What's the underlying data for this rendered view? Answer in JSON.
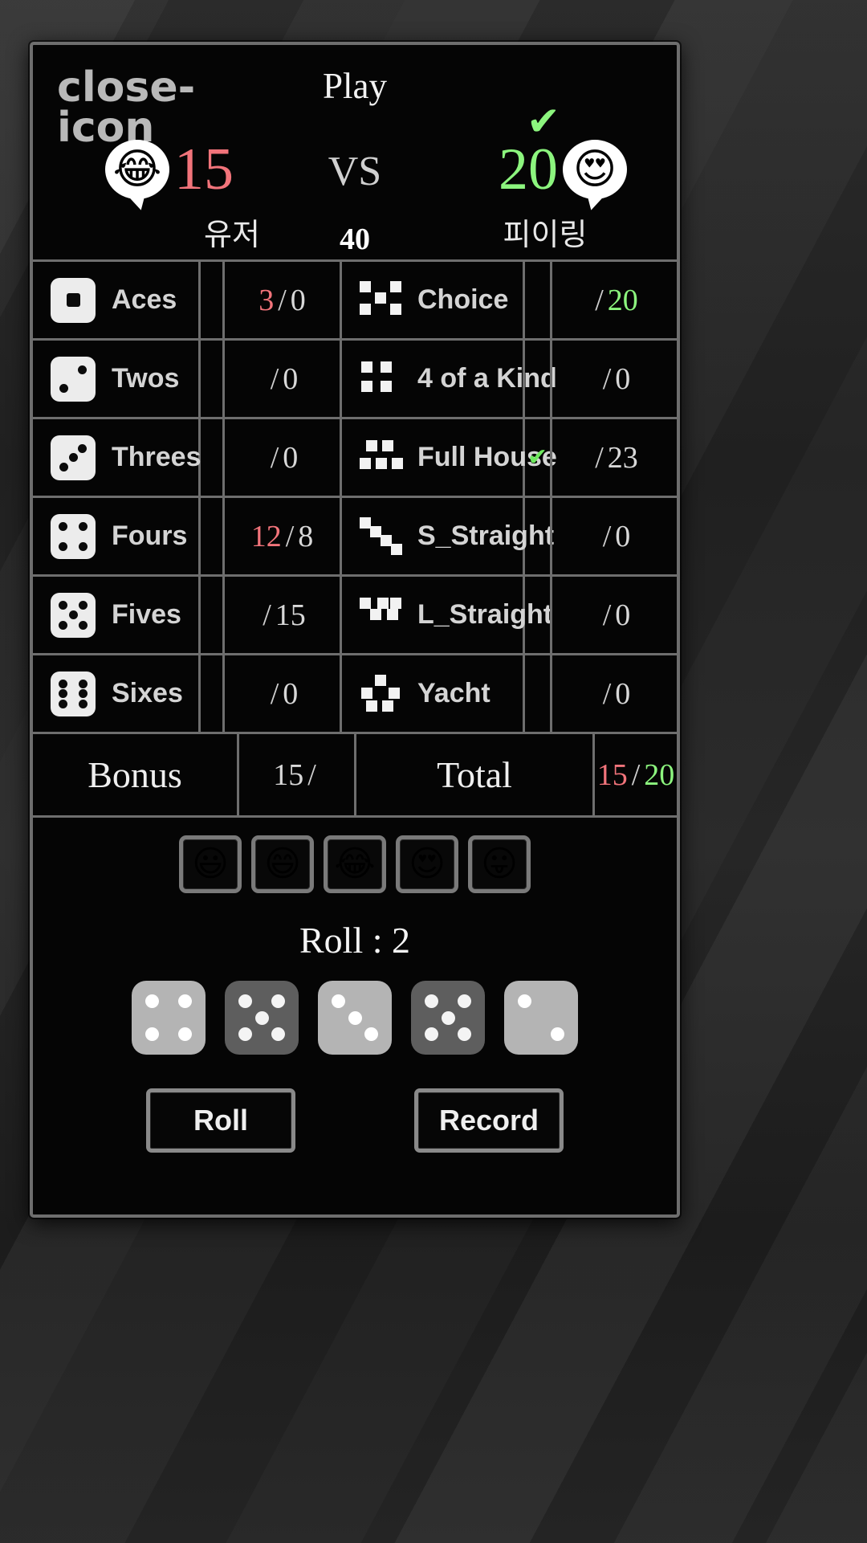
{
  "header": {
    "close_icon": "close-icon",
    "play_label": "Play",
    "vs_label": "VS",
    "target_score": "40",
    "ready_check": "✔",
    "left_player": {
      "avatar": "😂",
      "score": "15",
      "name": "유저",
      "color": "#f2747b"
    },
    "right_player": {
      "avatar": "😍",
      "score": "20",
      "name": "피이링",
      "color": "#8cf57e"
    }
  },
  "score_table": {
    "rows": [
      {
        "left": {
          "icon": "die-face-1",
          "label": "Aces",
          "mine": "3",
          "theirs": "0",
          "mine_color": "red",
          "theirs_color": "white",
          "checked": false
        },
        "right": {
          "icon": "choice-icon",
          "label": "Choice",
          "mine": "",
          "theirs": "20",
          "mine_color": "white",
          "theirs_color": "green",
          "checked": false
        }
      },
      {
        "left": {
          "icon": "die-face-2",
          "label": "Twos",
          "mine": "",
          "theirs": "0",
          "mine_color": "white",
          "theirs_color": "white",
          "checked": false
        },
        "right": {
          "icon": "four-of-a-kind-icon",
          "label": "4 of a Kind",
          "mine": "",
          "theirs": "0",
          "mine_color": "white",
          "theirs_color": "white",
          "checked": false
        }
      },
      {
        "left": {
          "icon": "die-face-3",
          "label": "Threes",
          "mine": "",
          "theirs": "0",
          "mine_color": "white",
          "theirs_color": "white",
          "checked": false
        },
        "right": {
          "icon": "full-house-icon",
          "label": "Full House",
          "mine": "",
          "theirs": "23",
          "mine_color": "white",
          "theirs_color": "white",
          "checked": true
        }
      },
      {
        "left": {
          "icon": "die-face-4",
          "label": "Fours",
          "mine": "12",
          "theirs": "8",
          "mine_color": "red",
          "theirs_color": "white",
          "checked": false
        },
        "right": {
          "icon": "s-straight-icon",
          "label": "S_Straight",
          "mine": "",
          "theirs": "0",
          "mine_color": "white",
          "theirs_color": "white",
          "checked": false
        }
      },
      {
        "left": {
          "icon": "die-face-5",
          "label": "Fives",
          "mine": "",
          "theirs": "15",
          "mine_color": "white",
          "theirs_color": "white",
          "checked": false
        },
        "right": {
          "icon": "l-straight-icon",
          "label": "L_Straight",
          "mine": "",
          "theirs": "0",
          "mine_color": "white",
          "theirs_color": "white",
          "checked": false
        }
      },
      {
        "left": {
          "icon": "die-face-6",
          "label": "Sixes",
          "mine": "",
          "theirs": "0",
          "mine_color": "white",
          "theirs_color": "white",
          "checked": false
        },
        "right": {
          "icon": "yacht-icon",
          "label": "Yacht",
          "mine": "",
          "theirs": "0",
          "mine_color": "white",
          "theirs_color": "white",
          "checked": false
        }
      }
    ],
    "summary": {
      "bonus_label": "Bonus",
      "bonus_mine": "15",
      "bonus_theirs": "",
      "total_label": "Total",
      "total_mine": "15",
      "total_theirs": "20"
    },
    "slash": "/"
  },
  "bottom": {
    "emojis": [
      {
        "glyph": "😃",
        "name": "emoji-grinning"
      },
      {
        "glyph": "😄",
        "name": "emoji-smiling"
      },
      {
        "glyph": "😂",
        "name": "emoji-joy"
      },
      {
        "glyph": "😍",
        "name": "emoji-heart-eyes"
      },
      {
        "glyph": "😛",
        "name": "emoji-tongue"
      }
    ],
    "roll_counter": "Roll : 2",
    "dice": [
      {
        "pips": 4,
        "held": true
      },
      {
        "pips": 5,
        "held": false
      },
      {
        "pips": 3,
        "held": true
      },
      {
        "pips": 5,
        "held": false
      },
      {
        "pips": 2,
        "held": true
      }
    ],
    "roll_button": "Roll",
    "record_button": "Record"
  },
  "colors": {
    "mine": "#f2747b",
    "theirs": "#8cf57e",
    "neutral": "#d8d8d8",
    "border": "#6e6e6e",
    "panel_bg": "#050505"
  }
}
